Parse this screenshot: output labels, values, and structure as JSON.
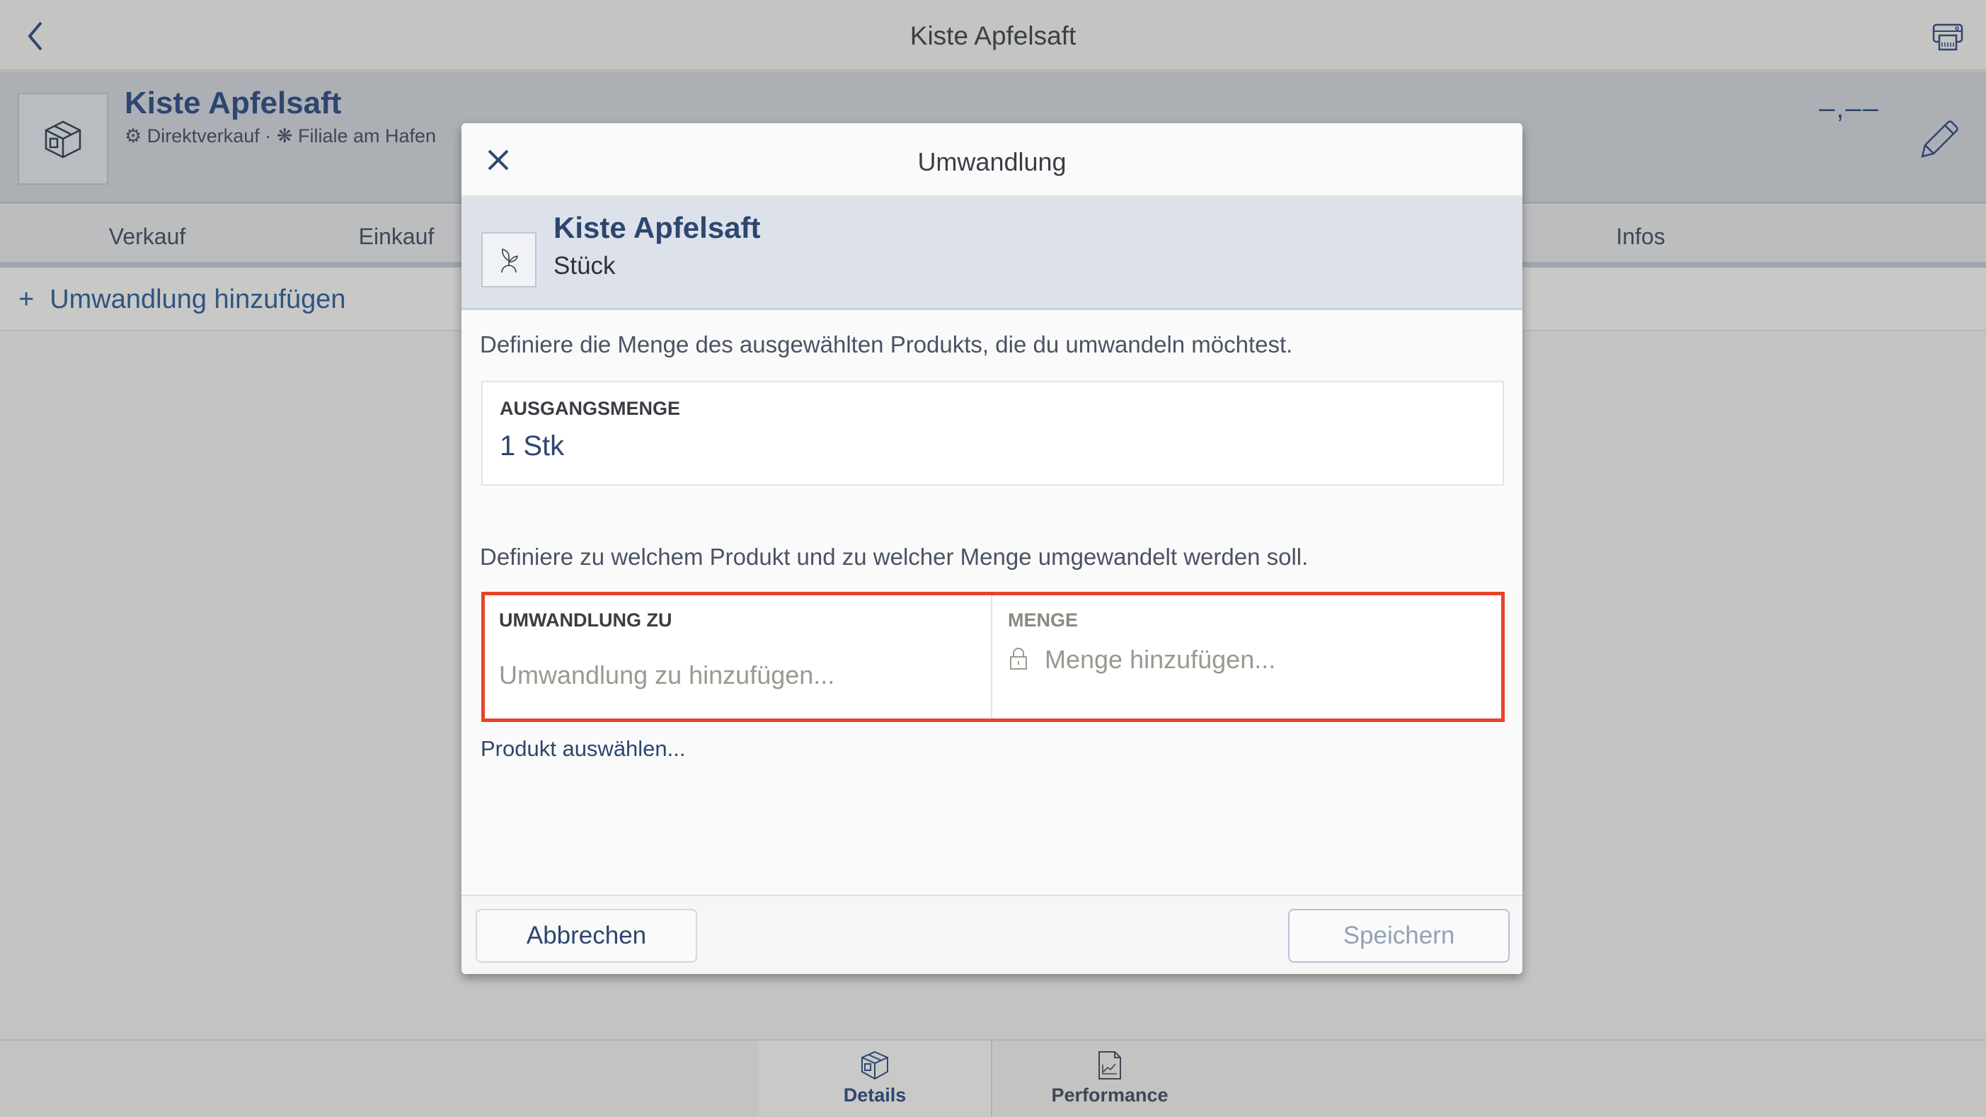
{
  "topbar": {
    "title": "Kiste Apfelsaft",
    "back_icon": "chevron-left-icon",
    "print_icon": "label-printer-icon"
  },
  "header": {
    "title": "Kiste Apfelsaft",
    "channel": "Direktverkauf",
    "separator": "·",
    "location": "Filiale am Hafen",
    "price": "–,––"
  },
  "tabs": [
    {
      "label": "Verkauf"
    },
    {
      "label": "Einkauf"
    },
    {
      "label": "Infos"
    }
  ],
  "add_row": {
    "icon": "+",
    "label": "Umwandlung hinzufügen"
  },
  "bottom_nav": [
    {
      "label": "Details",
      "active": true
    },
    {
      "label": "Performance",
      "active": false
    }
  ],
  "modal": {
    "title": "Umwandlung",
    "product": {
      "name": "Kiste Apfelsaft",
      "unit": "Stück"
    },
    "desc1": "Definiere die Menge des ausgewählten Produkts, die du umwandeln möchtest.",
    "source": {
      "label": "AUSGANGSMENGE",
      "value": "1 Stk"
    },
    "desc2": "Definiere zu welchem Produkt und zu welcher Menge umgewandelt werden soll.",
    "target": {
      "label": "UMWANDLUNG ZU",
      "placeholder": "Umwandlung zu hinzufügen..."
    },
    "quantity": {
      "label": "MENGE",
      "placeholder": "Menge hinzufügen...",
      "locked": true
    },
    "select_link": "Produkt auswählen...",
    "cancel": "Abbrechen",
    "save": "Speichern"
  },
  "colors": {
    "accent": "#2d4670",
    "error": "#e8432a",
    "overlay": "#c4c4c3"
  }
}
